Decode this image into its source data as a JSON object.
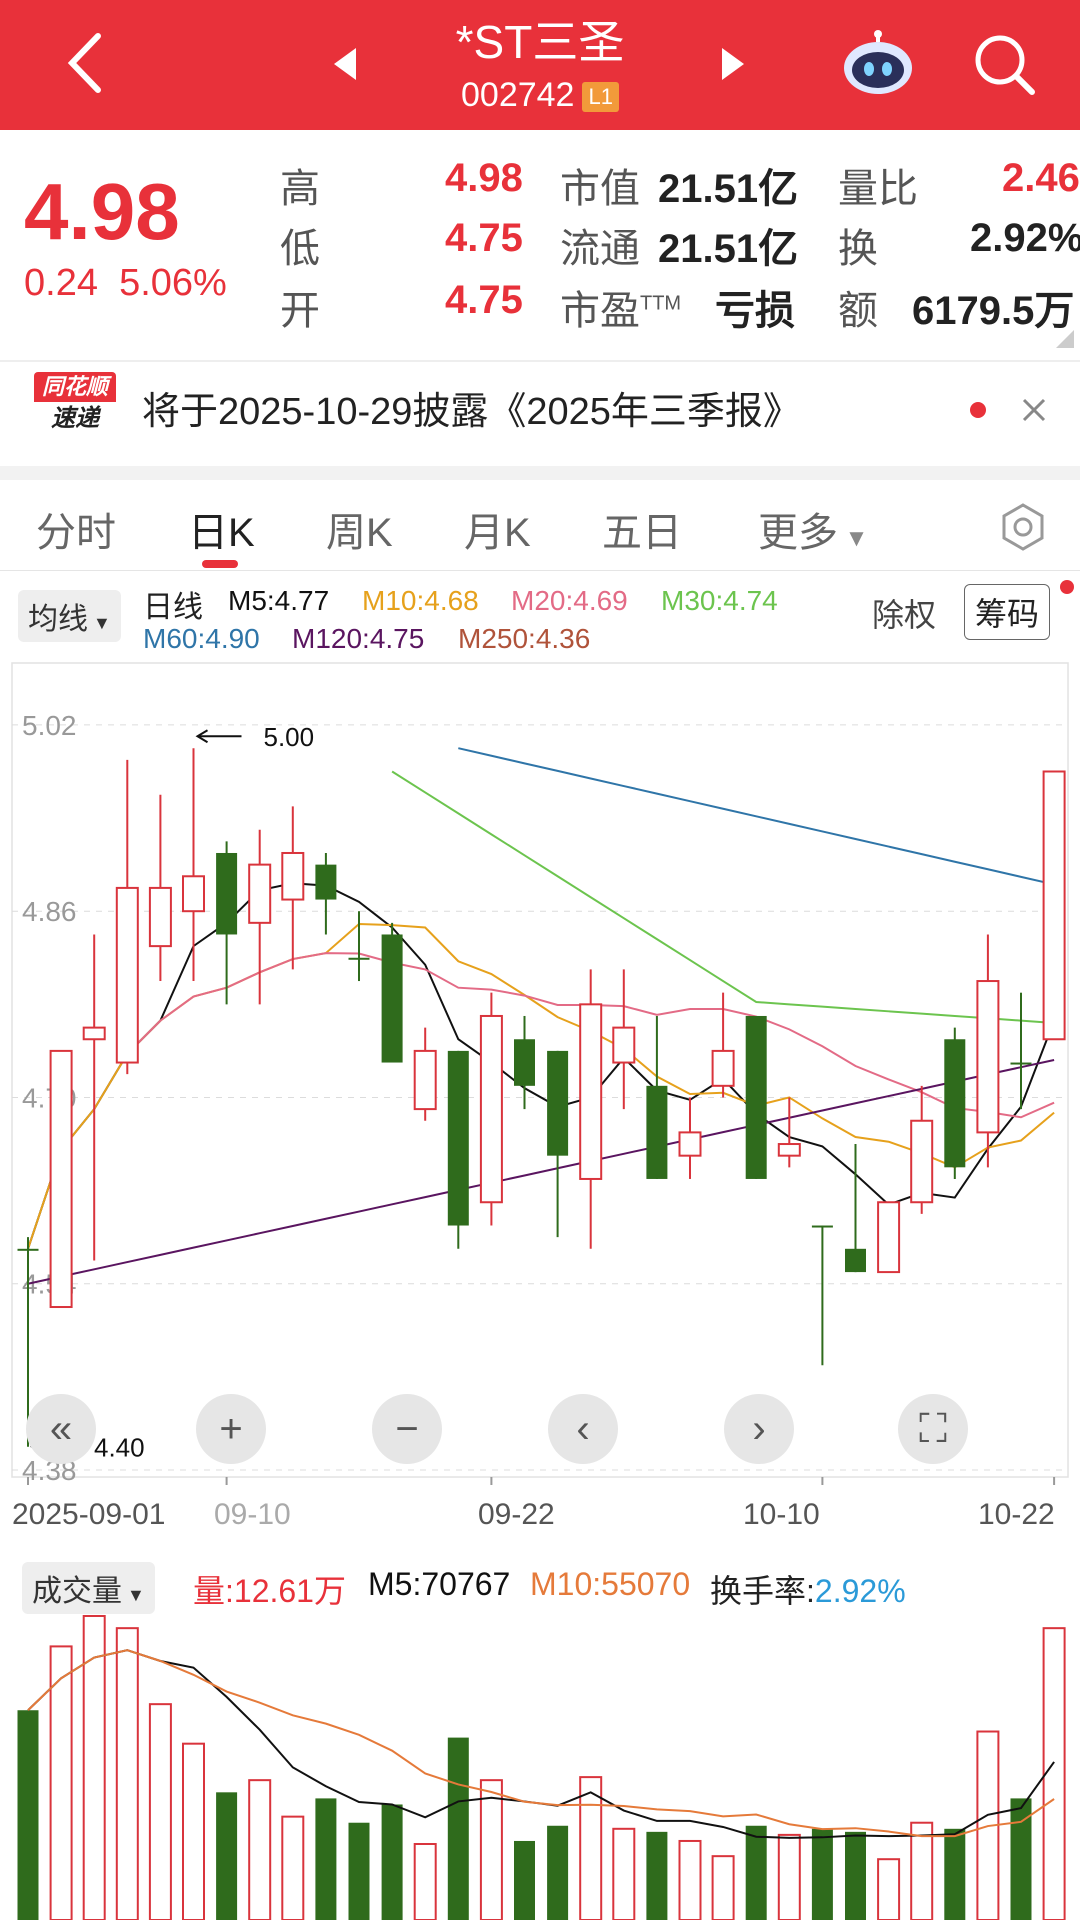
{
  "header": {
    "title": "*ST三圣",
    "code": "002742",
    "level_badge": "L1",
    "icons": [
      "back-icon",
      "prev-stock-icon",
      "next-stock-icon",
      "robot-assistant-icon",
      "search-icon"
    ]
  },
  "quote": {
    "price": "4.98",
    "change": "0.24",
    "change_pct": "5.06%",
    "high_label": "高",
    "high": "4.98",
    "low_label": "低",
    "low": "4.75",
    "open_label": "开",
    "open": "4.75",
    "mcap_label": "市值",
    "mcap": "21.51亿",
    "float_label": "流通",
    "float": "21.51亿",
    "pe_label": "市盈",
    "pe_sup": "TTM",
    "pe": "亏损",
    "vr_label": "量比",
    "vr": "2.46",
    "turn_label": "换",
    "turn": "2.92%",
    "amt_label": "额",
    "amt": "6179.5万"
  },
  "news": {
    "logo_top": "同花顺",
    "logo_bottom": "速递",
    "text": "将于2025-10-29披露《2025年三季报》"
  },
  "tabs": [
    "分时",
    "日K",
    "周K",
    "月K",
    "五日",
    "更多"
  ],
  "ma": {
    "selector": "均线",
    "period": "日线",
    "m5": "M5:4.77",
    "m10": "M10:4.68",
    "m20": "M20:4.69",
    "m30": "M30:4.74",
    "m60": "M60:4.90",
    "m120": "M120:4.75",
    "m250": "M250:4.36",
    "fq": "除权",
    "chip": "筹码",
    "colors": {
      "m5": "#111111",
      "m10": "#e6a11c",
      "m20": "#e36b86",
      "m30": "#6cc44e",
      "m60": "#2f75a8",
      "m120": "#5a1560",
      "m250": "#b0533a"
    }
  },
  "price_axis": [
    "5.02",
    "4.86",
    "4.70",
    "4.54",
    "4.38"
  ],
  "annotations": {
    "high": "5.00",
    "low": "4.40"
  },
  "date_axis": [
    "2025-09-01",
    "09-10",
    "09-22",
    "10-10",
    "10-22"
  ],
  "volume": {
    "selector": "成交量",
    "vol": "量:12.61万",
    "m5": "M5:70767",
    "m10": "M10:55070",
    "turnover_label": "换手率:",
    "turnover": "2.92%"
  },
  "colors": {
    "up": "#d9343c",
    "down": "#2f6b1c",
    "header": "#e8313a"
  },
  "chart_data": [
    {
      "type": "candlestick",
      "title": "日K",
      "ylim": [
        4.38,
        5.05
      ],
      "series": [
        {
          "o": 4.57,
          "c": 4.57,
          "h": 4.58,
          "l": 4.4,
          "dir": "down"
        },
        {
          "o": 4.52,
          "c": 4.74,
          "h": 4.74,
          "l": 4.52,
          "dir": "up"
        },
        {
          "o": 4.75,
          "c": 4.76,
          "h": 4.84,
          "l": 4.56,
          "dir": "up"
        },
        {
          "o": 4.73,
          "c": 4.88,
          "h": 4.99,
          "l": 4.72,
          "dir": "up"
        },
        {
          "o": 4.83,
          "c": 4.88,
          "h": 4.96,
          "l": 4.8,
          "dir": "up"
        },
        {
          "o": 4.86,
          "c": 4.89,
          "h": 5.0,
          "l": 4.8,
          "dir": "up"
        },
        {
          "o": 4.91,
          "c": 4.84,
          "h": 4.92,
          "l": 4.78,
          "dir": "down"
        },
        {
          "o": 4.85,
          "c": 4.9,
          "h": 4.93,
          "l": 4.78,
          "dir": "up"
        },
        {
          "o": 4.87,
          "c": 4.91,
          "h": 4.95,
          "l": 4.81,
          "dir": "up"
        },
        {
          "o": 4.9,
          "c": 4.87,
          "h": 4.91,
          "l": 4.84,
          "dir": "down"
        },
        {
          "o": 4.82,
          "c": 4.82,
          "h": 4.86,
          "l": 4.8,
          "dir": "down"
        },
        {
          "o": 4.84,
          "c": 4.73,
          "h": 4.85,
          "l": 4.73,
          "dir": "down"
        },
        {
          "o": 4.69,
          "c": 4.74,
          "h": 4.76,
          "l": 4.68,
          "dir": "up"
        },
        {
          "o": 4.74,
          "c": 4.59,
          "h": 4.74,
          "l": 4.57,
          "dir": "down"
        },
        {
          "o": 4.61,
          "c": 4.77,
          "h": 4.79,
          "l": 4.59,
          "dir": "up"
        },
        {
          "o": 4.75,
          "c": 4.71,
          "h": 4.77,
          "l": 4.69,
          "dir": "down"
        },
        {
          "o": 4.74,
          "c": 4.65,
          "h": 4.74,
          "l": 4.58,
          "dir": "down"
        },
        {
          "o": 4.63,
          "c": 4.78,
          "h": 4.81,
          "l": 4.57,
          "dir": "up"
        },
        {
          "o": 4.73,
          "c": 4.76,
          "h": 4.81,
          "l": 4.69,
          "dir": "up"
        },
        {
          "o": 4.71,
          "c": 4.63,
          "h": 4.77,
          "l": 4.63,
          "dir": "down"
        },
        {
          "o": 4.65,
          "c": 4.67,
          "h": 4.7,
          "l": 4.63,
          "dir": "up"
        },
        {
          "o": 4.71,
          "c": 4.74,
          "h": 4.79,
          "l": 4.7,
          "dir": "up"
        },
        {
          "o": 4.77,
          "c": 4.63,
          "h": 4.77,
          "l": 4.63,
          "dir": "down"
        },
        {
          "o": 4.65,
          "c": 4.66,
          "h": 4.7,
          "l": 4.64,
          "dir": "up"
        },
        {
          "o": 4.59,
          "c": 4.59,
          "h": 4.59,
          "l": 4.47,
          "dir": "down"
        },
        {
          "o": 4.57,
          "c": 4.55,
          "h": 4.66,
          "l": 4.55,
          "dir": "down"
        },
        {
          "o": 4.55,
          "c": 4.61,
          "h": 4.61,
          "l": 4.55,
          "dir": "up"
        },
        {
          "o": 4.61,
          "c": 4.68,
          "h": 4.71,
          "l": 4.6,
          "dir": "up"
        },
        {
          "o": 4.75,
          "c": 4.64,
          "h": 4.76,
          "l": 4.63,
          "dir": "down"
        },
        {
          "o": 4.67,
          "c": 4.8,
          "h": 4.84,
          "l": 4.64,
          "dir": "up"
        },
        {
          "o": 4.73,
          "c": 4.73,
          "h": 4.79,
          "l": 4.69,
          "dir": "down"
        },
        {
          "o": 4.75,
          "c": 4.98,
          "h": 4.98,
          "l": 4.75,
          "dir": "up"
        }
      ]
    },
    {
      "type": "bar",
      "title": "成交量",
      "series": [
        {
          "v": 0.69,
          "dir": "down"
        },
        {
          "v": 0.9,
          "dir": "up"
        },
        {
          "v": 1.0,
          "dir": "up"
        },
        {
          "v": 0.96,
          "dir": "up"
        },
        {
          "v": 0.71,
          "dir": "up"
        },
        {
          "v": 0.58,
          "dir": "up"
        },
        {
          "v": 0.42,
          "dir": "down"
        },
        {
          "v": 0.46,
          "dir": "up"
        },
        {
          "v": 0.34,
          "dir": "up"
        },
        {
          "v": 0.4,
          "dir": "down"
        },
        {
          "v": 0.32,
          "dir": "down"
        },
        {
          "v": 0.38,
          "dir": "down"
        },
        {
          "v": 0.25,
          "dir": "up"
        },
        {
          "v": 0.6,
          "dir": "down"
        },
        {
          "v": 0.46,
          "dir": "up"
        },
        {
          "v": 0.26,
          "dir": "down"
        },
        {
          "v": 0.31,
          "dir": "down"
        },
        {
          "v": 0.47,
          "dir": "up"
        },
        {
          "v": 0.3,
          "dir": "up"
        },
        {
          "v": 0.29,
          "dir": "down"
        },
        {
          "v": 0.26,
          "dir": "up"
        },
        {
          "v": 0.21,
          "dir": "up"
        },
        {
          "v": 0.31,
          "dir": "down"
        },
        {
          "v": 0.28,
          "dir": "up"
        },
        {
          "v": 0.3,
          "dir": "down"
        },
        {
          "v": 0.29,
          "dir": "down"
        },
        {
          "v": 0.2,
          "dir": "up"
        },
        {
          "v": 0.32,
          "dir": "up"
        },
        {
          "v": 0.3,
          "dir": "down"
        },
        {
          "v": 0.62,
          "dir": "up"
        },
        {
          "v": 0.4,
          "dir": "down"
        },
        {
          "v": 0.96,
          "dir": "up"
        }
      ]
    }
  ]
}
